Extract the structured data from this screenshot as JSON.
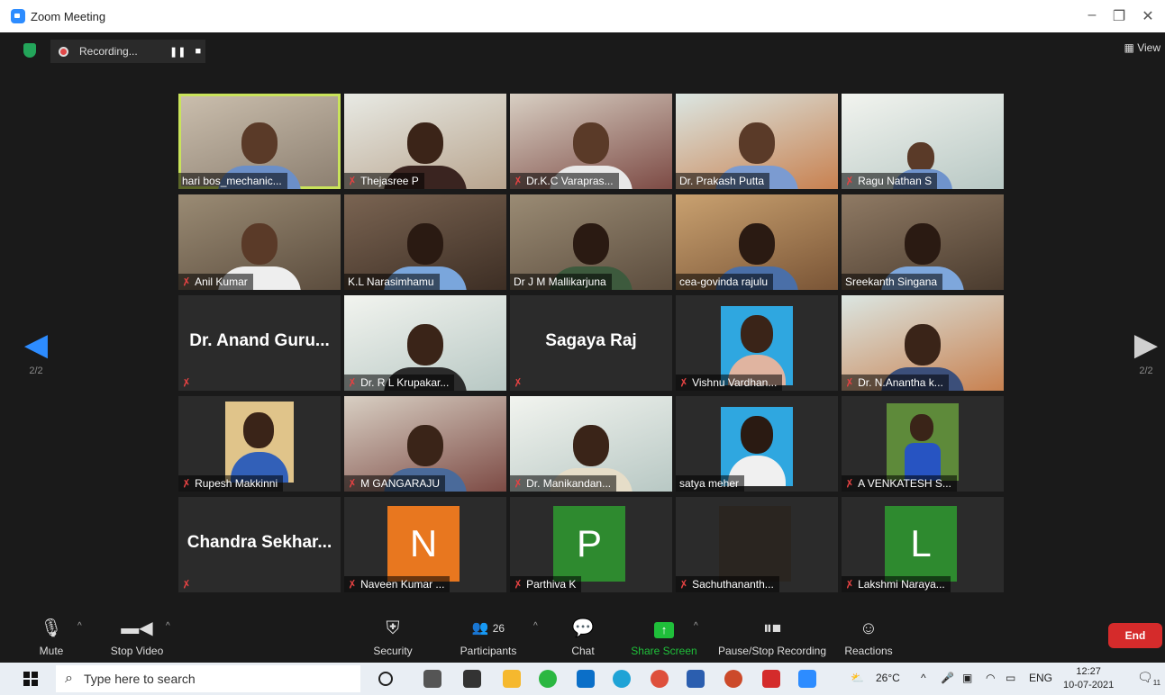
{
  "window": {
    "title": "Zoom Meeting",
    "minimize_icon": "minimize-icon",
    "restore_icon": "restore-icon",
    "close_icon": "close-icon"
  },
  "top_bar": {
    "recording_label": "Recording...",
    "pause_icon": "pause-icon",
    "stop_icon": "stop-icon",
    "view_label": "View"
  },
  "pagination": {
    "left": "2/2",
    "right": "2/2"
  },
  "colors": {
    "active_speaker_border": "#c9e35a",
    "mic_off": "#e34242",
    "end_button": "#d52b2b",
    "share_screen": "#1fbf3a",
    "avatar_n": "#e8771f",
    "avatar_p": "#2e8a2f",
    "avatar_l": "#2e8a2f"
  },
  "participants": [
    {
      "name": "hari bos_mechanic...",
      "muted": false,
      "active": true,
      "kind": "video"
    },
    {
      "name": "Thejasree P",
      "muted": true,
      "kind": "video"
    },
    {
      "name": "Dr.K.C Varapras...",
      "muted": true,
      "kind": "video"
    },
    {
      "name": "Dr. Prakash Putta",
      "muted": false,
      "kind": "video"
    },
    {
      "name": "Ragu Nathan S",
      "muted": true,
      "kind": "video"
    },
    {
      "name": "Anil Kumar",
      "muted": true,
      "kind": "video"
    },
    {
      "name": "K.L Narasimhamu",
      "muted": false,
      "kind": "video"
    },
    {
      "name": "Dr J M Mallikarjuna",
      "muted": false,
      "kind": "video"
    },
    {
      "name": "cea-govinda rajulu",
      "muted": false,
      "kind": "video"
    },
    {
      "name": "Sreekanth Singana",
      "muted": false,
      "kind": "video"
    },
    {
      "name": "Dr. Anand Guru...",
      "muted": true,
      "kind": "name"
    },
    {
      "name": "Dr. R L Krupakar...",
      "muted": true,
      "kind": "video"
    },
    {
      "name": "Sagaya Raj",
      "muted": true,
      "kind": "name"
    },
    {
      "name": "Vishnu Vardhan...",
      "muted": true,
      "kind": "photo"
    },
    {
      "name": "Dr. N.Anantha k...",
      "muted": true,
      "kind": "video"
    },
    {
      "name": "Rupesh Makkinni",
      "muted": true,
      "kind": "photo"
    },
    {
      "name": "M GANGARAJU",
      "muted": true,
      "kind": "video"
    },
    {
      "name": "Dr. Manikandan...",
      "muted": true,
      "kind": "video"
    },
    {
      "name": "satya meher",
      "muted": false,
      "kind": "photo"
    },
    {
      "name": "A VENKATESH S...",
      "muted": true,
      "kind": "photo"
    },
    {
      "name": "Chandra  Sekhar...",
      "muted": true,
      "kind": "name"
    },
    {
      "name": "Naveen Kumar ...",
      "muted": true,
      "kind": "letter",
      "letter": "N"
    },
    {
      "name": "Parthiva K",
      "muted": true,
      "kind": "letter",
      "letter": "P"
    },
    {
      "name": "Sachuthananth...",
      "muted": true,
      "kind": "book"
    },
    {
      "name": "Lakshmi Naraya...",
      "muted": true,
      "kind": "letter",
      "letter": "L"
    }
  ],
  "toolbar": {
    "mute": "Mute",
    "stop_video": "Stop Video",
    "security": "Security",
    "participants": "Participants",
    "participants_count": "26",
    "chat": "Chat",
    "share_screen": "Share Screen",
    "pause_stop_recording": "Pause/Stop Recording",
    "reactions": "Reactions",
    "end": "End"
  },
  "taskbar": {
    "search_placeholder": "Type here to search",
    "temperature": "26°C",
    "language": "ENG",
    "time": "12:27",
    "date": "10-07-2021",
    "notification_count": "11"
  }
}
